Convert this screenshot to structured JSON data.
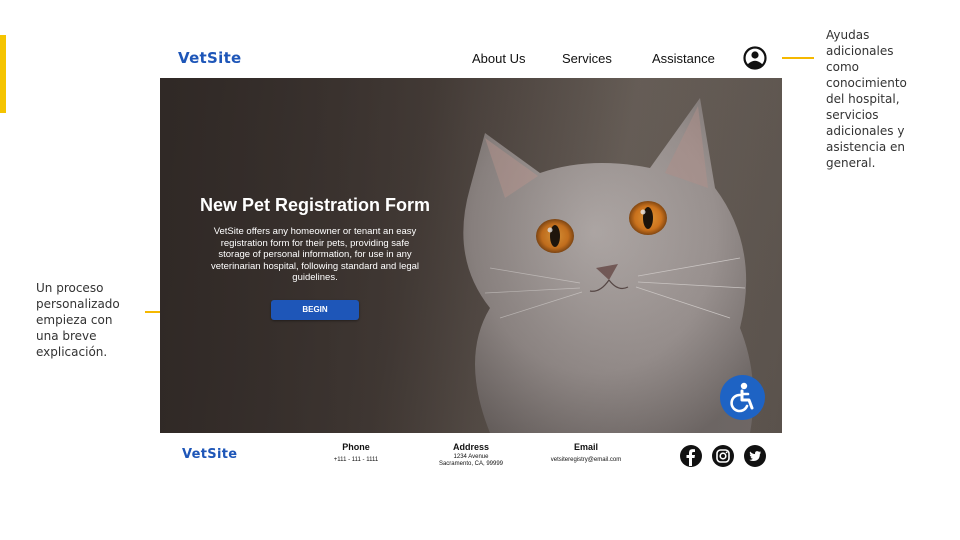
{
  "annotations": {
    "right_note": "Ayudas adicionales como conocimiento del hospital, servicios adicionales y asistencia en general.",
    "left_note": "Un proceso personalizado empieza con una breve explicación."
  },
  "site": {
    "logo": "VetSite",
    "nav": {
      "about": "About Us",
      "services": "Services",
      "assistance": "Assistance"
    },
    "hero": {
      "title": "New Pet Registration Form",
      "description": "VetSite offers any homeowner or tenant an easy registration form for their pets, providing safe storage of personal information, for use in any veterinarian hospital, following standard and legal guidelines.",
      "button": "BEGIN"
    },
    "footer": {
      "logo": "VetSite",
      "phone_label": "Phone",
      "phone_value": "+111 - 111 - 1111",
      "address_label": "Address",
      "address_line1": "1234 Avenue",
      "address_line2": "Sacramento, CA, 99999",
      "email_label": "Email",
      "email_value": "vetsiteregistry@email.com"
    }
  },
  "icons": [
    "user-icon",
    "accessibility-icon",
    "facebook-icon",
    "instagram-icon",
    "twitter-icon"
  ],
  "colors": {
    "brand": "#1e56b8",
    "accent": "#f5c400",
    "accessibility": "#1e63c4"
  }
}
